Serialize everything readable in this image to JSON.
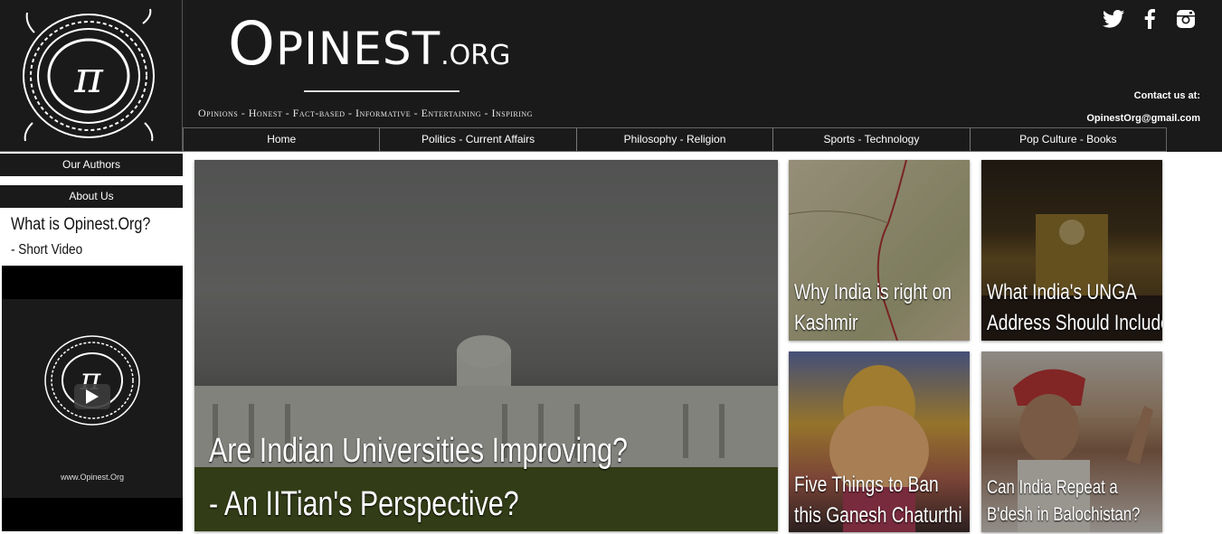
{
  "brand": {
    "name_first": "O",
    "name_rest": "PINEST",
    "name_suffix": ".ORG",
    "tagline": "Opinions - Honest - Fact-based - Informative - Entertaining - Inspiring",
    "logo_symbol": "π"
  },
  "social": [
    {
      "name": "twitter-icon"
    },
    {
      "name": "facebook-icon"
    },
    {
      "name": "instagram-icon"
    }
  ],
  "contact": {
    "label": "Contact us at:",
    "email": "OpinestOrg@gmail.com"
  },
  "nav": {
    "items": [
      {
        "label": "Home"
      },
      {
        "label": "Politics - Current Affairs"
      },
      {
        "label": "Philosophy - Religion"
      },
      {
        "label": "Sports - Technology"
      },
      {
        "label": "Pop Culture - Books"
      }
    ]
  },
  "sidebar": {
    "our_authors": "Our Authors",
    "about_us": "About Us",
    "video_title": "What is Opinest.Org?",
    "video_subtitle": "- Short Video",
    "video_url_text": "www.Opinest.Org",
    "video_symbol": "π"
  },
  "tiles": {
    "main_line1": "Are Indian Universities Improving?",
    "main_line2": "- An IITian's Perspective?",
    "kashmir_line1": "Why India is right on",
    "kashmir_line2": "Kashmir",
    "unga_line1": "What India's UNGA",
    "unga_line2": "Address Should Include",
    "ganesh_line1": "Five Things to Ban",
    "ganesh_line2": "this Ganesh Chaturthi",
    "modi_line1": "Can India Repeat a",
    "modi_line2": "B'desh in Balochistan?"
  },
  "colors": {
    "header_bg": "#1b1a1a",
    "text_light": "#ffffff"
  }
}
